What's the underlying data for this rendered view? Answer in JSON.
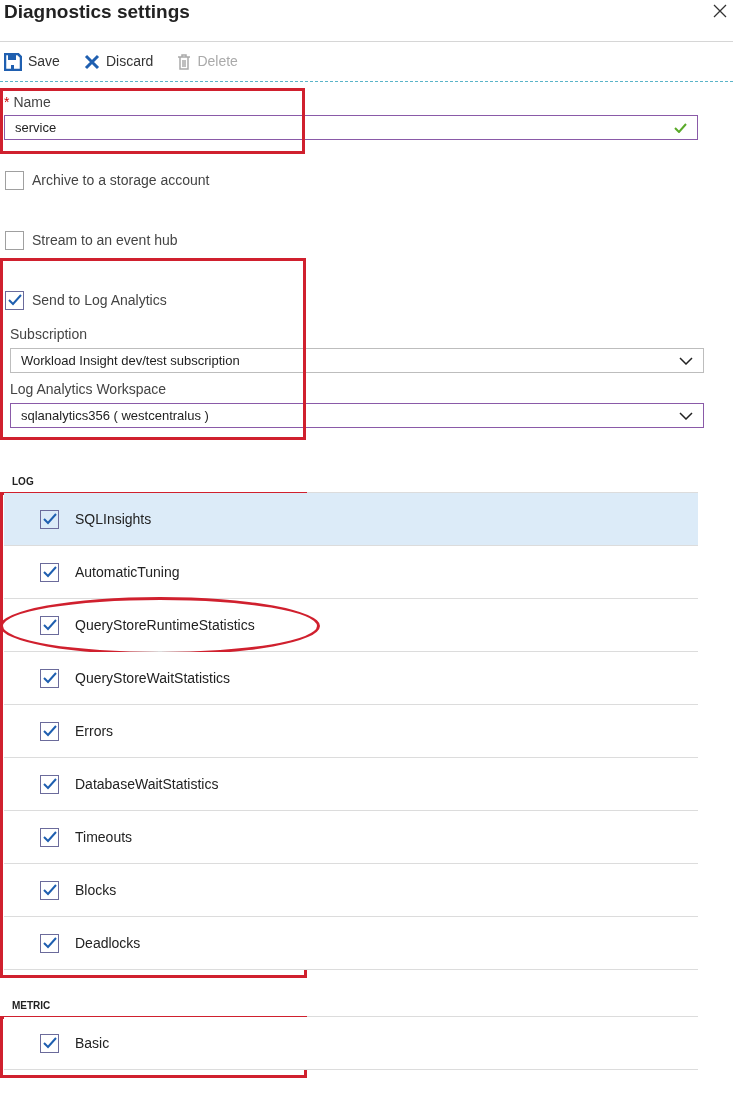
{
  "title": "Diagnostics settings",
  "toolbar": [
    {
      "kind": "save",
      "label": "Save",
      "disabled": false
    },
    {
      "kind": "discard",
      "label": "Discard",
      "disabled": false
    },
    {
      "kind": "delete",
      "label": "Delete",
      "disabled": true
    }
  ],
  "name_field": {
    "label": "Name",
    "required_mark": "*",
    "value": "service",
    "valid": true,
    "highlighted": true
  },
  "destinations": [
    {
      "label": "Archive to a storage account",
      "checked": false
    },
    {
      "label": "Stream to an event hub",
      "checked": false
    },
    {
      "label": "Send to Log Analytics",
      "checked": true
    }
  ],
  "log_analytics": {
    "highlighted": true,
    "fields": [
      {
        "label": "Subscription",
        "value": "Workload Insight dev/test subscription",
        "focused": false
      },
      {
        "label": "Log Analytics Workspace",
        "value": "sqlanalytics356 ( westcentralus )",
        "focused": true
      }
    ]
  },
  "log": {
    "heading": "LOG",
    "highlighted": true,
    "items": [
      {
        "label": "SQLInsights",
        "checked": true,
        "selected": true,
        "circled": false
      },
      {
        "label": "AutomaticTuning",
        "checked": true,
        "selected": false,
        "circled": false
      },
      {
        "label": "QueryStoreRuntimeStatistics",
        "checked": true,
        "selected": false,
        "circled": true
      },
      {
        "label": "QueryStoreWaitStatistics",
        "checked": true,
        "selected": false,
        "circled": false
      },
      {
        "label": "Errors",
        "checked": true,
        "selected": false,
        "circled": false
      },
      {
        "label": "DatabaseWaitStatistics",
        "checked": true,
        "selected": false,
        "circled": false
      },
      {
        "label": "Timeouts",
        "checked": true,
        "selected": false,
        "circled": false
      },
      {
        "label": "Blocks",
        "checked": true,
        "selected": false,
        "circled": false
      },
      {
        "label": "Deadlocks",
        "checked": true,
        "selected": false,
        "circled": false
      }
    ]
  },
  "metric": {
    "heading": "METRIC",
    "highlighted": true,
    "items": [
      {
        "label": "Basic",
        "checked": true,
        "selected": false,
        "circled": false
      }
    ]
  }
}
